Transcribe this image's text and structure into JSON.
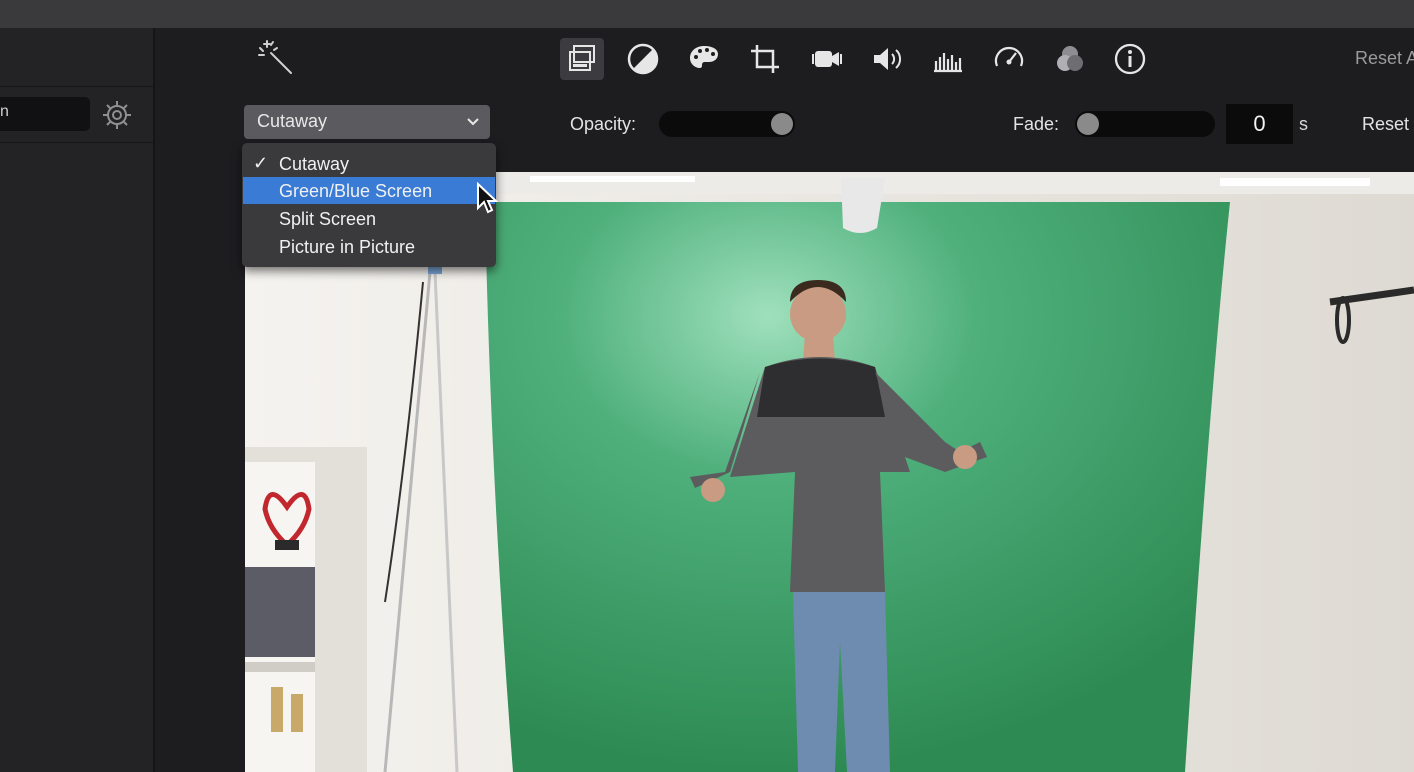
{
  "app": {
    "accent_color": "#3a7bd5",
    "topbar_color": "#3a3a3c"
  },
  "left_panel": {
    "search_value": "n",
    "gear_icon": "gear-icon"
  },
  "toolbar": {
    "wand_icon": "magic-wand-icon",
    "tools": [
      {
        "name": "video-overlay-settings",
        "icon": "overlay-icon",
        "active": true
      },
      {
        "name": "color-balance",
        "icon": "color-balance-icon",
        "active": false
      },
      {
        "name": "color-correction",
        "icon": "palette-icon",
        "active": false
      },
      {
        "name": "cropping",
        "icon": "crop-icon",
        "active": false
      },
      {
        "name": "stabilization",
        "icon": "camera-icon",
        "active": false
      },
      {
        "name": "volume",
        "icon": "speaker-icon",
        "active": false
      },
      {
        "name": "noise-reduction-equalizer",
        "icon": "equalizer-icon",
        "active": false
      },
      {
        "name": "speed",
        "icon": "speedometer-icon",
        "active": false
      },
      {
        "name": "clip-filter",
        "icon": "filter-icon",
        "active": false
      },
      {
        "name": "clip-info",
        "icon": "info-icon",
        "active": false
      }
    ],
    "reset_all_label": "Reset A"
  },
  "overlay": {
    "dropdown_value": "Cutaway",
    "opacity_label": "Opacity:",
    "opacity_value": 1.0,
    "fade_label": "Fade:",
    "fade_value": "0",
    "fade_unit": "s",
    "reset_label": "Reset"
  },
  "menu": {
    "items": [
      {
        "label": "Cutaway",
        "checked": true,
        "highlighted": false
      },
      {
        "label": "Green/Blue Screen",
        "checked": false,
        "highlighted": true
      },
      {
        "label": "Split Screen",
        "checked": false,
        "highlighted": false
      },
      {
        "label": "Picture in Picture",
        "checked": false,
        "highlighted": false
      }
    ],
    "check_glyph": "✓"
  }
}
